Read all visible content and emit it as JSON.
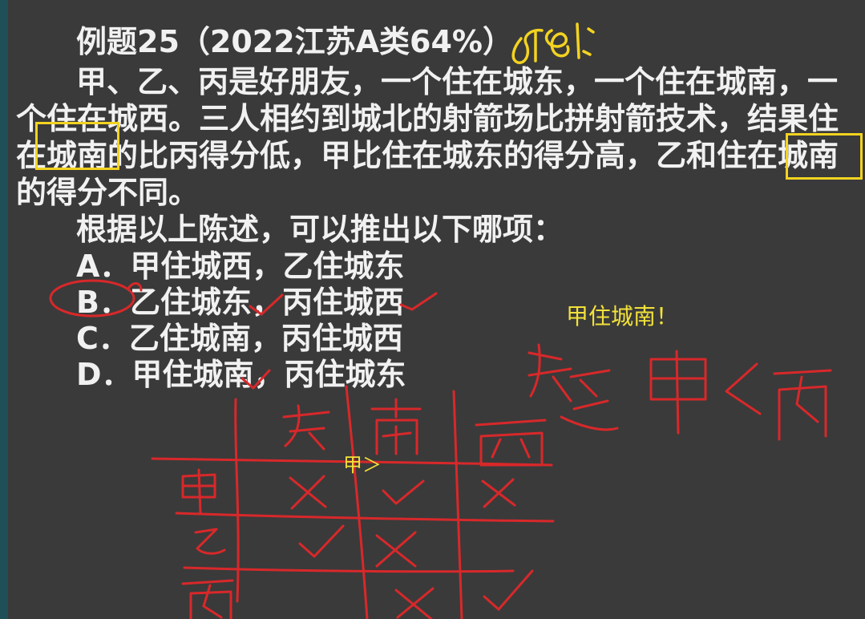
{
  "question": {
    "title": "例题25（2022江苏A类64%）",
    "lines": [
      "甲、乙、丙是好朋友，一个住在城东，一个住在城南，一",
      "个住在城西。三人相约到城北的射箭场比拼射箭技术，结果住",
      "在城南的比丙得分低，甲比住在城东的得分高，乙和住在城南",
      "的得分不同。"
    ],
    "prompt": "根据以上陈述，可以推出以下哪项：",
    "options": [
      "A．甲住城西，乙住城东",
      "B．乙住城东，丙住城西",
      "C．乙住城南，丙住城西",
      "D．甲住城南，丙住城东"
    ]
  },
  "annotations": {
    "correct_rate_note": "68%",
    "conclusion": "甲住城南！",
    "small_label": "甲＞",
    "table_headers": [
      "东",
      "南",
      "西"
    ],
    "table_rows": [
      "甲",
      "乙",
      "丙"
    ],
    "inequality": "东乙 甲＜丙",
    "selected_option": "B",
    "colors": {
      "highlight_box": "#f2d320",
      "red_ink": "#d8282a",
      "yellow_ink": "#f2d320",
      "text": "#f1f1f1",
      "background": "#3a3a3a"
    }
  }
}
